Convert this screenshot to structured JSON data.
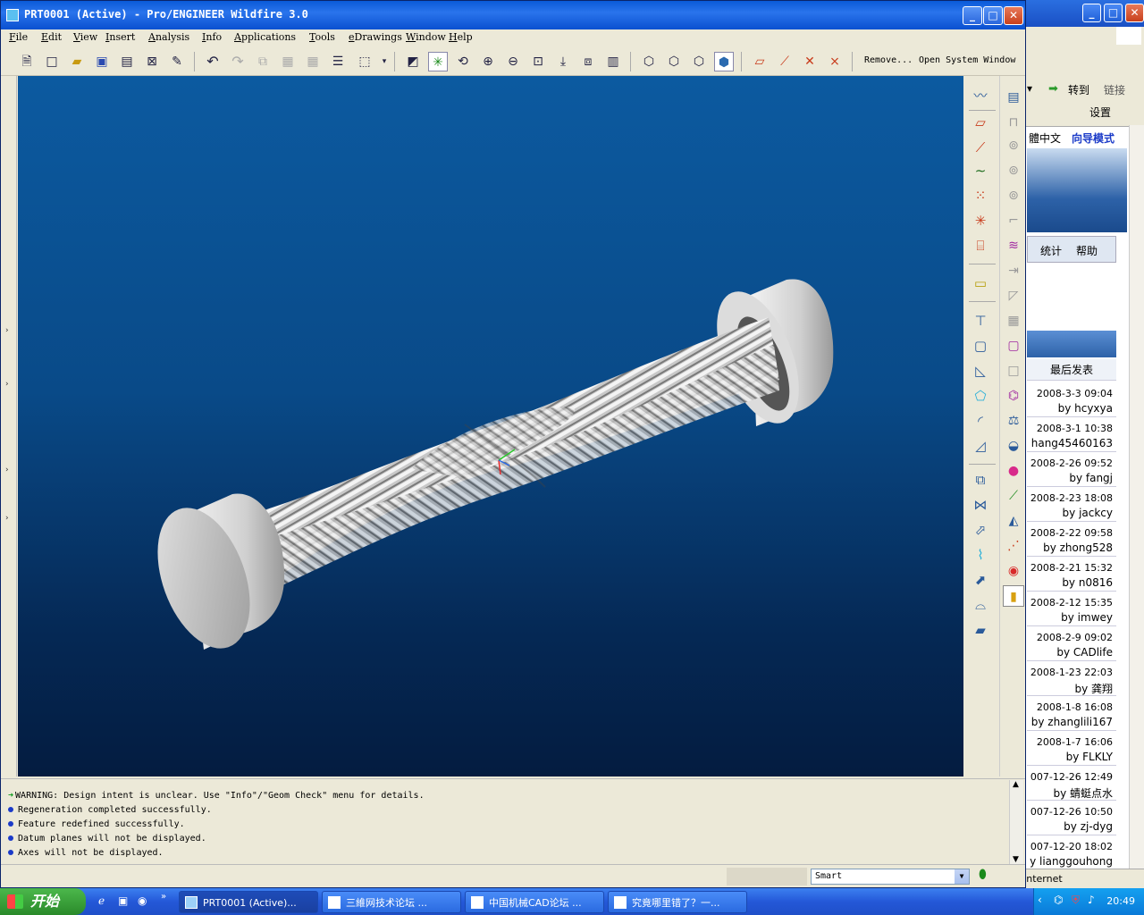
{
  "main_window": {
    "title": "PRT0001 (Active) - Pro/ENGINEER Wildfire 3.0",
    "minimize": "_",
    "maximize": "□",
    "close": "✕"
  },
  "menu": [
    "File",
    "Edit",
    "View",
    "Insert",
    "Analysis",
    "Info",
    "Applications",
    "Tools",
    "eDrawings",
    "Window",
    "Help"
  ],
  "toolbar": {
    "remove_label": "Remove...",
    "open_system_window_label": "Open System Window"
  },
  "messages": [
    {
      "type": "warning",
      "text": "WARNING: Design intent is unclear.  Use \"Info\"/\"Geom Check\" menu for details."
    },
    {
      "type": "info",
      "text": "Regeneration completed successfully."
    },
    {
      "type": "info",
      "text": "Feature redefined successfully."
    },
    {
      "type": "info",
      "text": "Datum planes will not be displayed."
    },
    {
      "type": "info",
      "text": "Axes will not be displayed."
    }
  ],
  "filter": {
    "value": "Smart"
  },
  "browser": {
    "goto": "转到",
    "links": "链接",
    "settings": "设置",
    "lang": "體中文",
    "guide_mode": "向导模式",
    "stats": "统计",
    "help": "帮助",
    "last_post": "最后发表",
    "status_text": "Internet",
    "posts": [
      {
        "date": "2008-3-3 09:04",
        "user": "by hcyxya"
      },
      {
        "date": "2008-3-1 10:38",
        "user": "hang45460163"
      },
      {
        "date": "2008-2-26 09:52",
        "user": "by fangj"
      },
      {
        "date": "2008-2-23 18:08",
        "user": "by jackcy"
      },
      {
        "date": "2008-2-22 09:58",
        "user": "by zhong528"
      },
      {
        "date": "2008-2-21 15:32",
        "user": "by n0816"
      },
      {
        "date": "2008-2-12 15:35",
        "user": "by imwey"
      },
      {
        "date": "2008-2-9 09:02",
        "user": "by CADlife"
      },
      {
        "date": "2008-1-23 22:03",
        "user": "by 龚翔"
      },
      {
        "date": "2008-1-8 16:08",
        "user": "by zhanglili167"
      },
      {
        "date": "2008-1-7 16:06",
        "user": "by FLKLY"
      },
      {
        "date": "007-12-26 12:49",
        "user": "by 蜻蜓点水"
      },
      {
        "date": "007-12-26 10:50",
        "user": "by zj-dyg"
      },
      {
        "date": "007-12-20 18:02",
        "user": "y lianggouhong"
      }
    ]
  },
  "taskbar": {
    "start": "开始",
    "items": [
      {
        "label": "PRT0001 (Active)...",
        "active": true
      },
      {
        "label": "三維网技术论坛 ...",
        "active": false
      },
      {
        "label": "中国机械CAD论坛 ...",
        "active": false
      },
      {
        "label": "究竟哪里错了？一...",
        "active": false
      }
    ],
    "clock": "20:49"
  }
}
